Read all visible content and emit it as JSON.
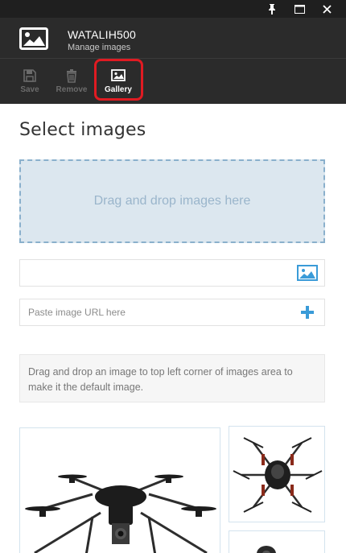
{
  "window": {
    "pin_icon": "pin-icon",
    "maximize_icon": "maximize-icon",
    "close_icon": "close-icon"
  },
  "header": {
    "title": "WATALIH500",
    "subtitle": "Manage images",
    "icon": "image-icon"
  },
  "toolbar": {
    "save_label": "Save",
    "remove_label": "Remove",
    "gallery_label": "Gallery",
    "save_icon": "floppy-disk-icon",
    "remove_icon": "trash-icon",
    "gallery_icon": "image-icon",
    "highlight_color": "#e01b22"
  },
  "main": {
    "title": "Select images",
    "dropzone_text": "Drag and drop images here",
    "file_input_value": "",
    "file_icon": "image-icon",
    "url_placeholder": "Paste image URL here",
    "add_icon": "plus-icon",
    "hint_text": "Drag and drop an image to top left corner of images area to make it the default image."
  },
  "gallery": {
    "images": [
      "drone-front-view",
      "drone-top-view",
      "drone-camera-partial"
    ]
  },
  "colors": {
    "accent": "#3a9bd8",
    "header_bg": "#2b2b2b",
    "titlebar_bg": "#1f1f1f",
    "dropzone_bg": "#dce7ef",
    "dropzone_border": "#8ab0cc"
  }
}
